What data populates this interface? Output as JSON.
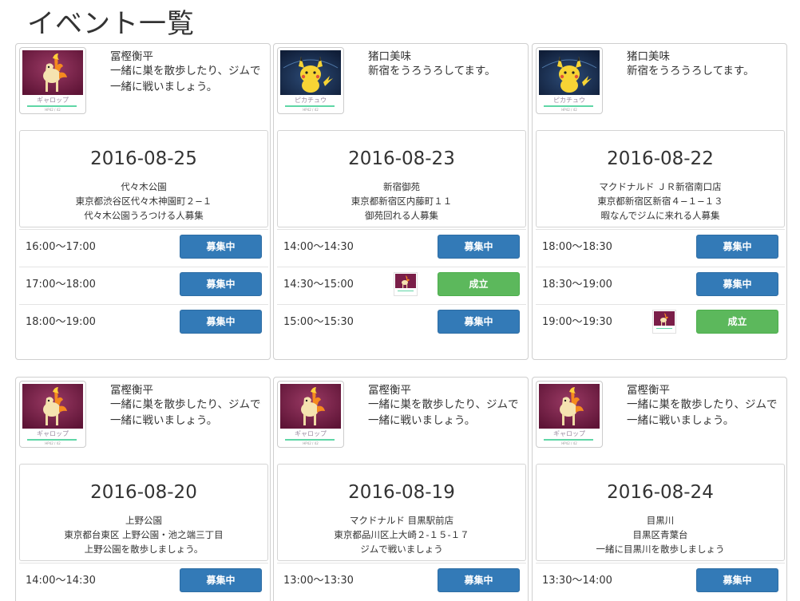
{
  "page_title": "イベント一覧",
  "icons": {
    "ponyta": {
      "label": "ギャロップ",
      "hp": "HP42 / 42"
    },
    "pikachu": {
      "label": "ピカチュウ",
      "hp": "HP42 / 42"
    }
  },
  "cards": [
    {
      "name": "冨樫衡平",
      "message": "一緒に巣を散歩したり、ジムで一緒に戦いましょう。",
      "avatar": "ponyta",
      "date": "2016-08-25",
      "place": "代々木公園",
      "address": "東京都渋谷区代々木神園町２−１",
      "description": "代々木公園うろつける人募集",
      "slots": [
        {
          "time": "16:00〜17:00",
          "button": "募集中",
          "status": "open"
        },
        {
          "time": "17:00〜18:00",
          "button": "募集中",
          "status": "open"
        },
        {
          "time": "18:00〜19:00",
          "button": "募集中",
          "status": "open"
        }
      ]
    },
    {
      "name": "猪口美味",
      "message": "新宿をうろうろしてます。",
      "avatar": "pikachu",
      "date": "2016-08-23",
      "place": "新宿御苑",
      "address": "東京都新宿区内藤町１１",
      "description": "御苑回れる人募集",
      "slots": [
        {
          "time": "14:00〜14:30",
          "button": "募集中",
          "status": "open"
        },
        {
          "time": "14:30〜15:00",
          "button": "成立",
          "status": "matched",
          "participant": "ponyta"
        },
        {
          "time": "15:00〜15:30",
          "button": "募集中",
          "status": "open"
        }
      ]
    },
    {
      "name": "猪口美味",
      "message": "新宿をうろうろしてます。",
      "avatar": "pikachu",
      "date": "2016-08-22",
      "place": "マクドナルド ＪＲ新宿南口店",
      "address": "東京都新宿区新宿４−１−１３",
      "description": "暇なんでジムに来れる人募集",
      "slots": [
        {
          "time": "18:00〜18:30",
          "button": "募集中",
          "status": "open"
        },
        {
          "time": "18:30〜19:00",
          "button": "募集中",
          "status": "open"
        },
        {
          "time": "19:00〜19:30",
          "button": "成立",
          "status": "matched",
          "participant": "ponyta"
        }
      ]
    },
    {
      "name": "冨樫衡平",
      "message": "一緒に巣を散歩したり、ジムで一緒に戦いましょう。",
      "avatar": "ponyta",
      "date": "2016-08-20",
      "place": "上野公園",
      "address": "東京都台東区 上野公園・池之端三丁目",
      "description": "上野公園を散歩しましょう。",
      "slots": [
        {
          "time": "14:00〜14:30",
          "button": "募集中",
          "status": "open"
        }
      ]
    },
    {
      "name": "冨樫衡平",
      "message": "一緒に巣を散歩したり、ジムで一緒に戦いましょう。",
      "avatar": "ponyta",
      "date": "2016-08-19",
      "place": "マクドナルド 目黒駅前店",
      "address": "東京都品川区上大崎２-１５-１７",
      "description": "ジムで戦いましょう",
      "slots": [
        {
          "time": "13:00〜13:30",
          "button": "募集中",
          "status": "open"
        }
      ]
    },
    {
      "name": "冨樫衡平",
      "message": "一緒に巣を散歩したり、ジムで一緒に戦いましょう。",
      "avatar": "ponyta",
      "date": "2016-08-24",
      "place": "目黒川",
      "address": "目黒区青葉台",
      "description": "一緒に目黒川を散歩しましょう",
      "slots": [
        {
          "time": "13:30〜14:00",
          "button": "募集中",
          "status": "open"
        }
      ]
    }
  ],
  "colors": {
    "primary": "#337ab7",
    "success": "#5cb85c",
    "ponyta_bg": "#7a1e48",
    "pikachu_bg": "#152845"
  }
}
